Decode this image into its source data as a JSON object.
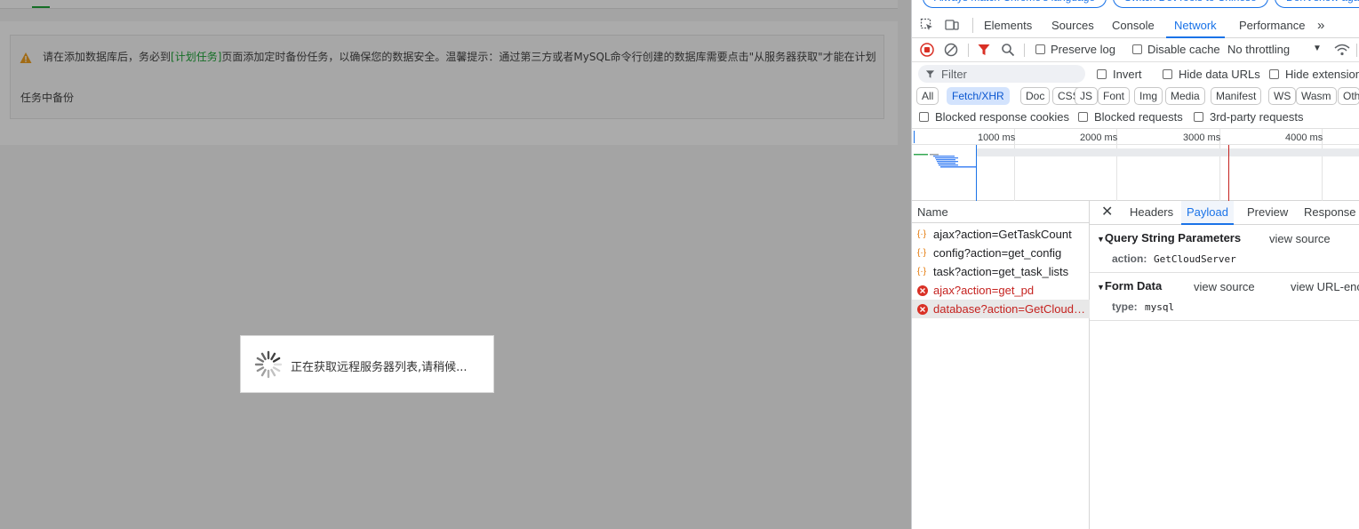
{
  "page": {
    "notice_prefix": "请在添加数据库后，务必到",
    "notice_link": "[计划任务]",
    "notice_suffix": "页面添加定时备份任务，以确保您的数据安全。温馨提示：通过第三方或者MySQL命令行创建的数据库需要点击\"从服务器获取\"才能在计划",
    "notice_line2": "任务中备份",
    "loading_text": "正在获取远程服务器列表,请稍候..."
  },
  "devtools": {
    "banner": [
      "Always match Chrome's language",
      "Switch DevTools to Chinese",
      "Don't show again"
    ],
    "tabs": [
      "Elements",
      "Sources",
      "Console",
      "Network",
      "Performance"
    ],
    "active_tab": "Network",
    "toolbar": {
      "preserve_log": "Preserve log",
      "disable_cache": "Disable cache",
      "throttling": "No throttling"
    },
    "filter": {
      "placeholder": "Filter",
      "invert": "Invert",
      "hide_data_urls": "Hide data URLs",
      "hide_extension": "Hide extension URLs"
    },
    "type_chips": [
      "All",
      "Fetch/XHR",
      "Doc",
      "CSS",
      "JS",
      "Font",
      "Img",
      "Media",
      "Manifest",
      "WS",
      "Wasm",
      "Other"
    ],
    "active_chip": "Fetch/XHR",
    "blocked": {
      "cookies": "Blocked response cookies",
      "requests": "Blocked requests",
      "third_party": "3rd-party requests"
    },
    "timeline_ticks": [
      "1000 ms",
      "2000 ms",
      "3000 ms",
      "4000 ms"
    ],
    "list_header": "Name",
    "requests": [
      {
        "name": "ajax?action=GetTaskCount",
        "status": "ok"
      },
      {
        "name": "config?action=get_config",
        "status": "ok"
      },
      {
        "name": "task?action=get_task_lists",
        "status": "ok"
      },
      {
        "name": "ajax?action=get_pd",
        "status": "error"
      },
      {
        "name": "database?action=GetCloudServer",
        "status": "error"
      }
    ],
    "detail_tabs": [
      "Headers",
      "Payload",
      "Preview",
      "Response"
    ],
    "active_detail_tab": "Payload",
    "payload": {
      "query_title": "Query String Parameters",
      "query_view_source": "view source",
      "query_key": "action:",
      "query_value": "GetCloudServer",
      "form_title": "Form Data",
      "form_view_source": "view source",
      "form_view_url": "view URL-encoded",
      "form_key": "type:",
      "form_value": "mysql"
    }
  },
  "colors": {
    "accent": "#1a73e8",
    "error": "#c5221f",
    "bt_green": "#20a53a",
    "warning": "#f0a020"
  }
}
